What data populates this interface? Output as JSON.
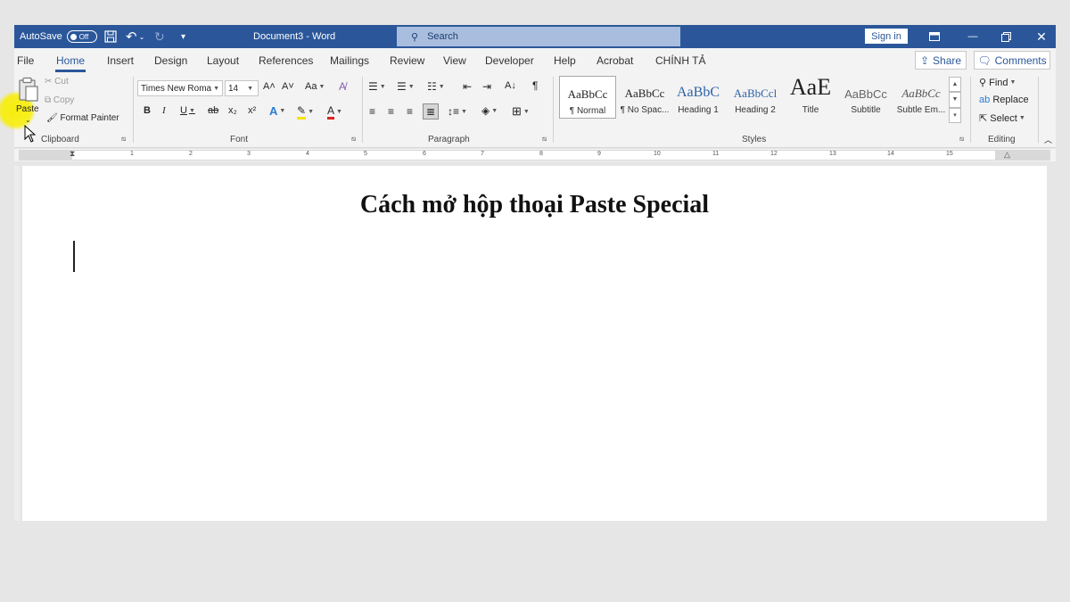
{
  "titlebar": {
    "autosave_label": "AutoSave",
    "autosave_state": "Off",
    "doc_name": "Document3  -  Word",
    "search_placeholder": "Search",
    "signin_label": "Sign in",
    "bg_color": "#2b579a"
  },
  "tabs": [
    "File",
    "Home",
    "Insert",
    "Design",
    "Layout",
    "References",
    "Mailings",
    "Review",
    "View",
    "Developer",
    "Help",
    "Acrobat",
    "CHÍNH TẢ"
  ],
  "active_tab": "Home",
  "share_label": "Share",
  "comments_label": "Comments",
  "clipboard": {
    "paste_label": "Paste",
    "cut_label": "Cut",
    "copy_label": "Copy",
    "format_painter_label": "Format Painter",
    "group_label": "Clipboard"
  },
  "font": {
    "font_name": "Times New Roma",
    "font_size": "14",
    "group_label": "Font",
    "case_label": "Aa"
  },
  "paragraph": {
    "group_label": "Paragraph"
  },
  "styles": {
    "items": [
      {
        "sample": "AaBbCc",
        "name": "¶ Normal"
      },
      {
        "sample": "AaBbCc",
        "name": "¶ No Spac..."
      },
      {
        "sample": "AaBbC",
        "name": "Heading 1"
      },
      {
        "sample": "AaBbCcl",
        "name": "Heading 2"
      },
      {
        "sample": "AaE",
        "name": "Title"
      },
      {
        "sample": "AaBbCc",
        "name": "Subtitle"
      },
      {
        "sample": "AaBbCc",
        "name": "Subtle Em..."
      }
    ],
    "group_label": "Styles"
  },
  "editing": {
    "find_label": "Find",
    "replace_label": "Replace",
    "select_label": "Select",
    "group_label": "Editing"
  },
  "ruler": {
    "numbers": [
      "1",
      "2",
      "3",
      "4",
      "5",
      "6",
      "7",
      "8",
      "9",
      "10",
      "11",
      "12",
      "13",
      "14",
      "15"
    ]
  },
  "document": {
    "heading": "Cách mở hộp thoại Paste Special"
  }
}
